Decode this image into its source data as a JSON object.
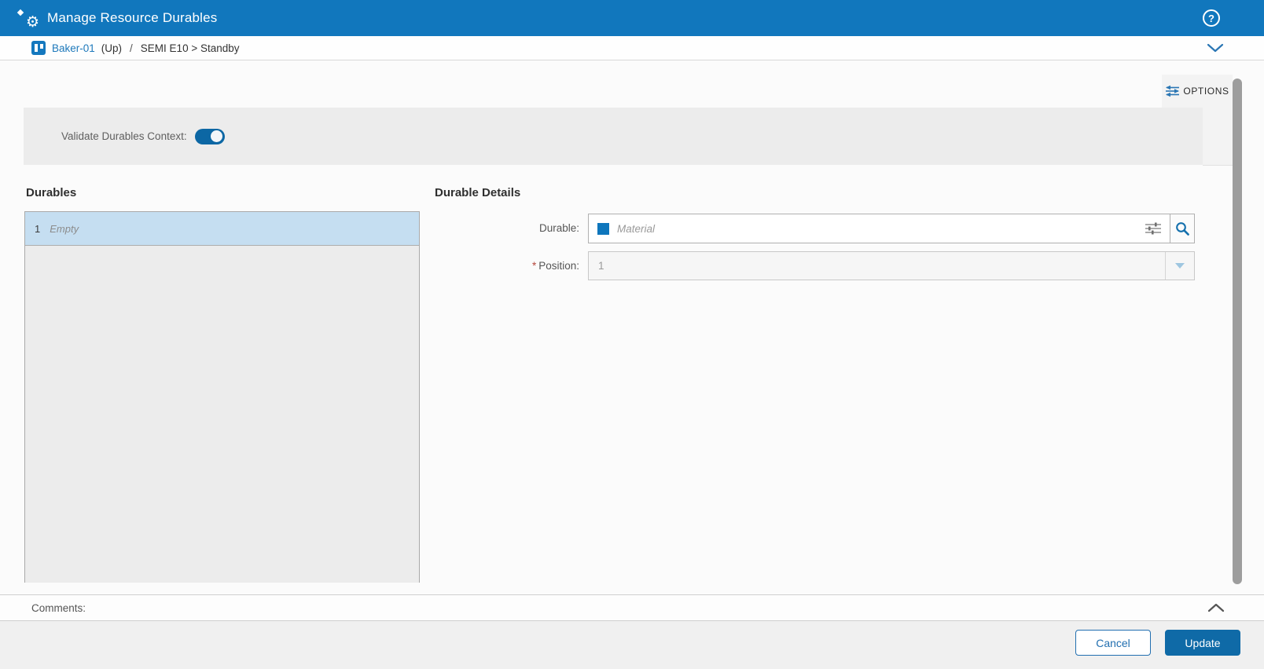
{
  "colors": {
    "header_blue": "#1177bd",
    "accent_blue": "#2a76b4",
    "toggle_blue": "#0c67a4",
    "selected_row_blue": "#c5def1",
    "update_button_blue": "#0f6aa7",
    "required_red": "#b5473c"
  },
  "header": {
    "title": "Manage Resource Durables"
  },
  "breadcrumb": {
    "resource_link": "Baker-01",
    "up_label": "(Up)",
    "separator": "/",
    "state_path": "SEMI E10 > Standby"
  },
  "options_tab": {
    "label": "OPTIONS"
  },
  "context_panel": {
    "validate_label": "Validate Durables Context:",
    "toggle_state": "on"
  },
  "durables_panel": {
    "heading": "Durables",
    "rows": [
      {
        "position": "1",
        "content": "Empty"
      }
    ]
  },
  "details_panel": {
    "heading": "Durable Details",
    "durable_field": {
      "label": "Durable:",
      "placeholder": "Material"
    },
    "position_field": {
      "label": "Position:",
      "required_marker": "*",
      "value": "1"
    }
  },
  "comments_bar": {
    "label": "Comments:"
  },
  "footer": {
    "cancel_label": "Cancel",
    "update_label": "Update"
  },
  "icons": {
    "title": "gear-wizard",
    "help": "circled-question-mark",
    "breadcrumb_resource": "resource-entity",
    "breadcrumb_expand": "chevron-down",
    "options": "sliders",
    "durable_input_filter": "sliders",
    "durable_input_search": "magnifier",
    "position_dropdown": "triangle-down",
    "comments_collapse": "chevron-up"
  }
}
